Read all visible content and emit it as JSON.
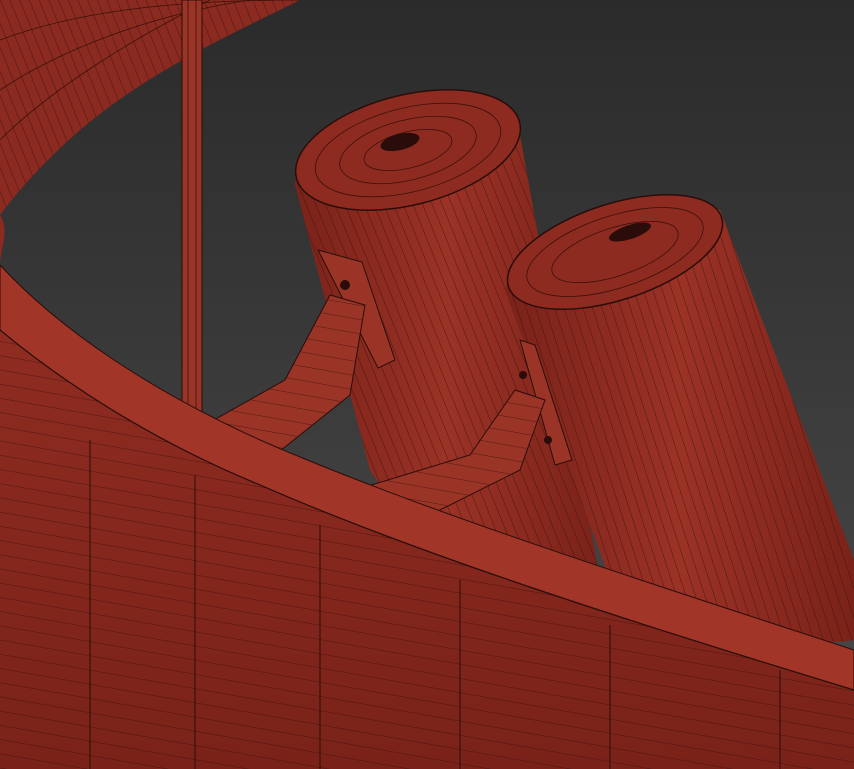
{
  "viewport": {
    "background_top": "#2b2b2b",
    "background_bottom": "#4a4a4a"
  },
  "model": {
    "fill_color": "#8b2a20",
    "fill_dark": "#6e1f17",
    "fill_light": "#a63a2c",
    "wire_color": "#2a0d0a",
    "wire_light": "#c5675a"
  },
  "parts": [
    {
      "name": "outer-ring-arc"
    },
    {
      "name": "inner-ring-arc"
    },
    {
      "name": "vertical-rod"
    },
    {
      "name": "left-cylinder-light"
    },
    {
      "name": "right-cylinder-light"
    },
    {
      "name": "left-mounting-bracket"
    },
    {
      "name": "right-mounting-bracket"
    }
  ]
}
